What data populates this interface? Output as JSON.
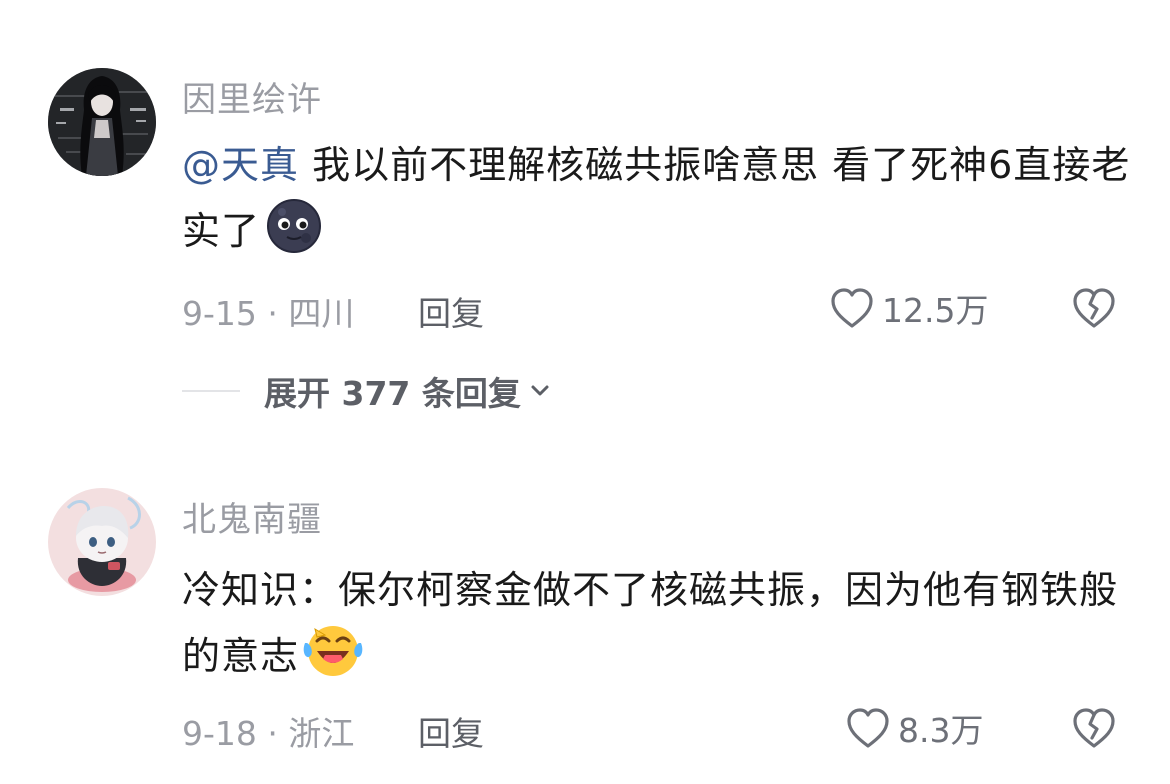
{
  "comments": [
    {
      "username": "因里绘许",
      "mention": "@天真",
      "text": " 我以前不理解核磁共振啥意思 看了死神6直接老实了",
      "emoji": "moon-face-emoji",
      "date": "9-15",
      "location": "四川",
      "reply_label": "回复",
      "likes": "12.5万"
    },
    {
      "username": "北鬼南疆",
      "text": "冷知识：保尔柯察金做不了核磁共振，因为他有钢铁般的意志",
      "emoji": "laughing-tears-emoji",
      "date": "9-18",
      "location": "浙江",
      "reply_label": "回复",
      "likes": "8.3万"
    }
  ],
  "expand_replies": {
    "prefix": "展开",
    "count": "377",
    "suffix": "条回复"
  },
  "icons": {
    "like": "heart-outline-icon",
    "dislike": "broken-heart-icon",
    "expand": "chevron-down-icon"
  },
  "colors": {
    "mention": "#3a5b92",
    "meta": "#9a9ca3",
    "text": "#1a1a1a"
  }
}
